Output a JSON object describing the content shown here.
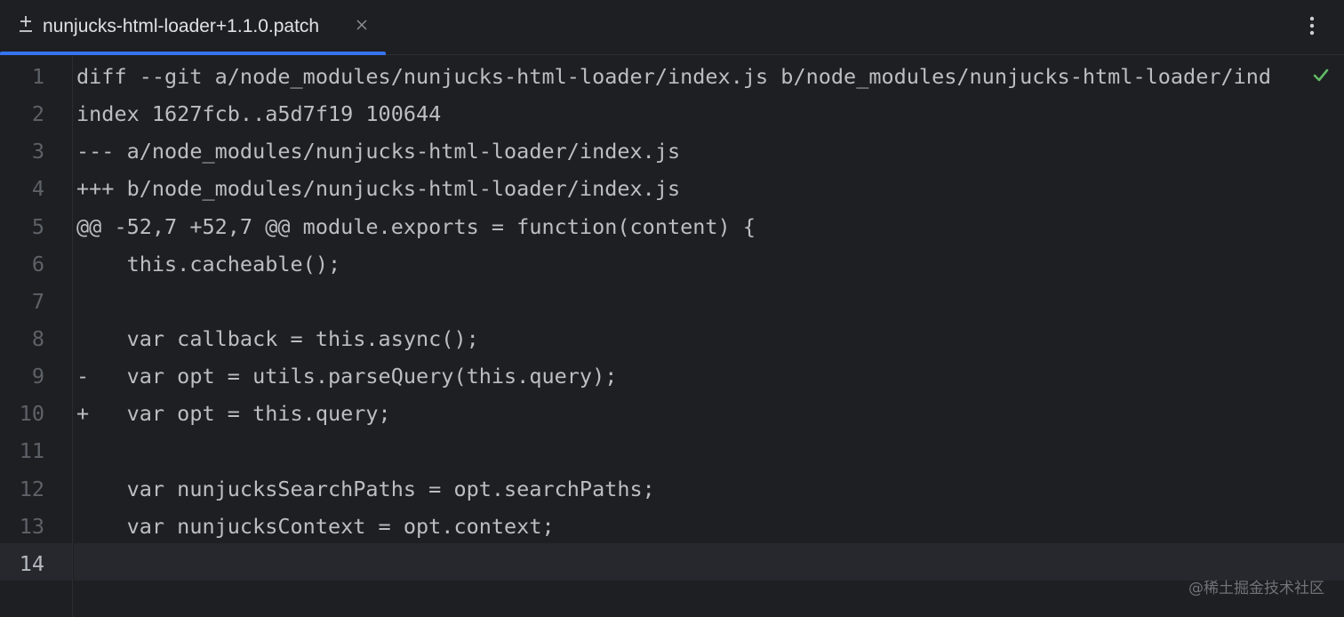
{
  "tab": {
    "title": "nunjucks-html-loader+1.1.0.patch",
    "icon": "patch-file-icon",
    "close_icon": "close-icon"
  },
  "toolbar": {
    "more_icon": "more-vertical-icon"
  },
  "editor": {
    "current_line": 14,
    "line_numbers": [
      "1",
      "2",
      "3",
      "4",
      "5",
      "6",
      "7",
      "8",
      "9",
      "10",
      "11",
      "12",
      "13",
      "14"
    ],
    "lines": [
      "diff --git a/node_modules/nunjucks-html-loader/index.js b/node_modules/nunjucks-html-loader/ind",
      "index 1627fcb..a5d7f19 100644",
      "--- a/node_modules/nunjucks-html-loader/index.js",
      "+++ b/node_modules/nunjucks-html-loader/index.js",
      "@@ -52,7 +52,7 @@ module.exports = function(content) {",
      "    this.cacheable();",
      "",
      "    var callback = this.async();",
      "-   var opt = utils.parseQuery(this.query);",
      "+   var opt = this.query;",
      "",
      "    var nunjucksSearchPaths = opt.searchPaths;",
      "    var nunjucksContext = opt.context;",
      ""
    ],
    "inspection_icon": "checkmark-icon",
    "inspection_color": "#5fb865"
  },
  "watermark": "@稀土掘金技术社区"
}
